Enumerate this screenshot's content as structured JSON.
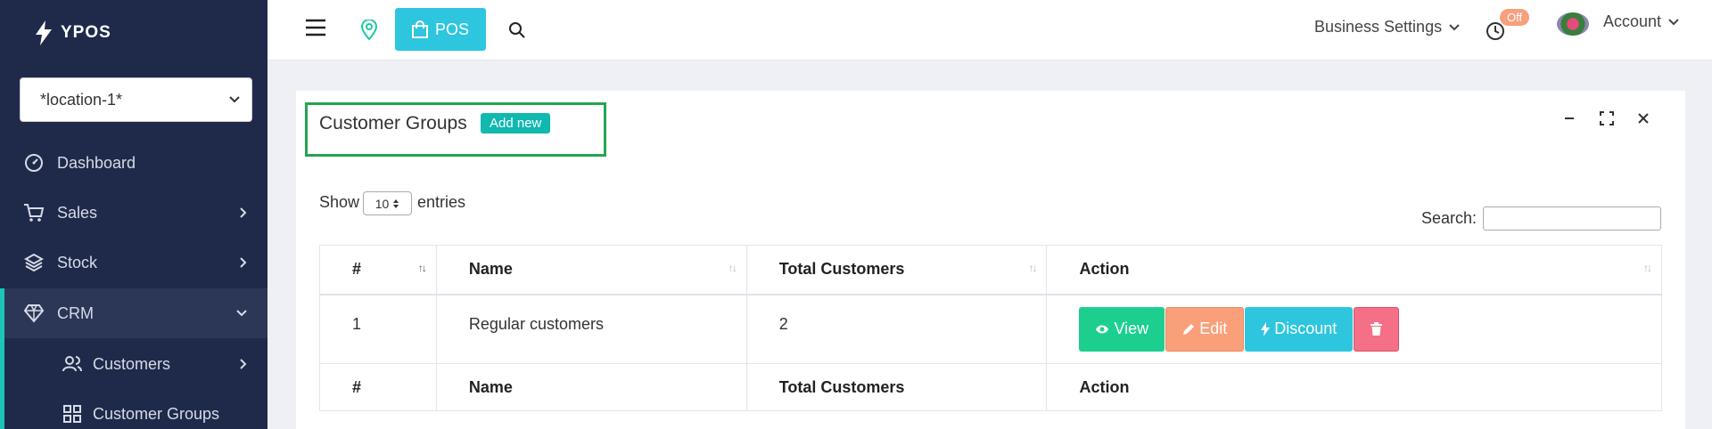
{
  "brand": {
    "name": "YPOS"
  },
  "sidebar": {
    "location_value": "*location-1*",
    "items": [
      {
        "label": "Dashboard",
        "icon": "dashboard-icon",
        "has_chevron": false
      },
      {
        "label": "Sales",
        "icon": "cart-icon",
        "has_chevron": true
      },
      {
        "label": "Stock",
        "icon": "layers-icon",
        "has_chevron": true
      },
      {
        "label": "CRM",
        "icon": "diamond-icon",
        "has_chevron": true,
        "active": true
      }
    ],
    "subitems": [
      {
        "label": "Customers",
        "icon": "users-icon",
        "has_chevron": true
      },
      {
        "label": "Customer Groups",
        "icon": "grid-icon",
        "has_chevron": false
      }
    ]
  },
  "topbar": {
    "pos_label": "POS",
    "business_settings": "Business Settings",
    "off_badge": "Off",
    "account": "Account"
  },
  "card": {
    "title": "Customer Groups",
    "add_new": "Add new"
  },
  "table_controls": {
    "show_label": "Show",
    "page_size": "10",
    "entries_label": "entries",
    "search_label": "Search:",
    "search_value": ""
  },
  "table": {
    "columns": [
      "#",
      "Name",
      "Total Customers",
      "Action"
    ],
    "rows": [
      {
        "index": "1",
        "name": "Regular customers",
        "total": "2"
      }
    ],
    "actions": {
      "view": "View",
      "edit": "Edit",
      "discount": "Discount"
    }
  },
  "colors": {
    "sidebar_bg": "#1f2a4a",
    "accent_teal": "#1cc5b5",
    "pos_button": "#2ec6de",
    "view_button": "#1ccf8f",
    "edit_button": "#f9a07a",
    "discount_button": "#2ec6de",
    "delete_button": "#f56f86",
    "highlight_box": "#22a650"
  }
}
